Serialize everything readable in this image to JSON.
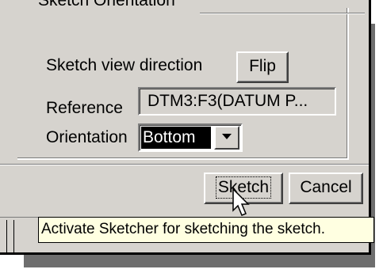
{
  "group": {
    "title": "Sketch Orientation"
  },
  "sketch_view_direction": {
    "label": "Sketch view direction",
    "flip_label": "Flip"
  },
  "reference": {
    "label": "Reference",
    "value": "DTM3:F3(DATUM P..."
  },
  "orientation": {
    "label": "Orientation",
    "selected": "Bottom"
  },
  "buttons": {
    "sketch_label": "Sketch",
    "cancel_label": "Cancel"
  },
  "tooltip": {
    "text": "Activate Sketcher for sketching the sketch."
  },
  "icons": {
    "dropdown": "chevron-down-icon",
    "cursor": "pointer-cursor-icon"
  },
  "colors": {
    "dialog_bg": "#d6d3ce",
    "selection_bg": "#000000",
    "selection_fg": "#ffffff",
    "tooltip_bg": "#ffffe1"
  }
}
